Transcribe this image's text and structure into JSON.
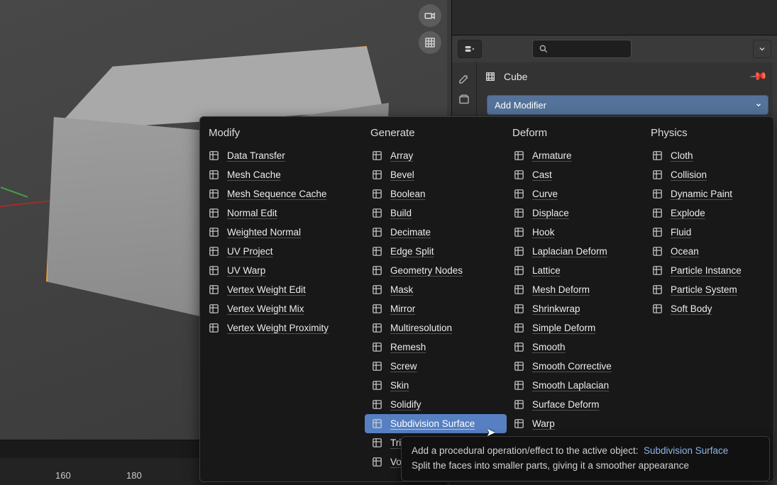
{
  "viewport": {
    "nav_buttons": [
      "camera-icon",
      "grid-icon"
    ]
  },
  "timeline": {
    "frames": [
      "160",
      "180"
    ]
  },
  "properties": {
    "search_placeholder": "",
    "object_name": "Cube",
    "add_modifier_label": "Add Modifier"
  },
  "menu": {
    "headers": {
      "modify": "Modify",
      "generate": "Generate",
      "deform": "Deform",
      "physics": "Physics"
    },
    "modify": [
      "Data Transfer",
      "Mesh Cache",
      "Mesh Sequence Cache",
      "Normal Edit",
      "Weighted Normal",
      "UV Project",
      "UV Warp",
      "Vertex Weight Edit",
      "Vertex Weight Mix",
      "Vertex Weight Proximity"
    ],
    "generate": [
      "Array",
      "Bevel",
      "Boolean",
      "Build",
      "Decimate",
      "Edge Split",
      "Geometry Nodes",
      "Mask",
      "Mirror",
      "Multiresolution",
      "Remesh",
      "Screw",
      "Skin",
      "Solidify",
      "Subdivision Surface",
      "Tri",
      "Vo"
    ],
    "deform": [
      "Armature",
      "Cast",
      "Curve",
      "Displace",
      "Hook",
      "Laplacian Deform",
      "Lattice",
      "Mesh Deform",
      "Shrinkwrap",
      "Simple Deform",
      "Smooth",
      "Smooth Corrective",
      "Smooth Laplacian",
      "Surface Deform",
      "Warp"
    ],
    "physics": [
      "Cloth",
      "Collision",
      "Dynamic Paint",
      "Explode",
      "Fluid",
      "Ocean",
      "Particle Instance",
      "Particle System",
      "Soft Body"
    ],
    "hovered": "Subdivision Surface"
  },
  "tooltip": {
    "line1_prefix": "Add a procedural operation/effect to the active object:",
    "line1_name": "Subdivision Surface",
    "line2": "Split the faces into smaller parts, giving it a smoother appearance"
  }
}
